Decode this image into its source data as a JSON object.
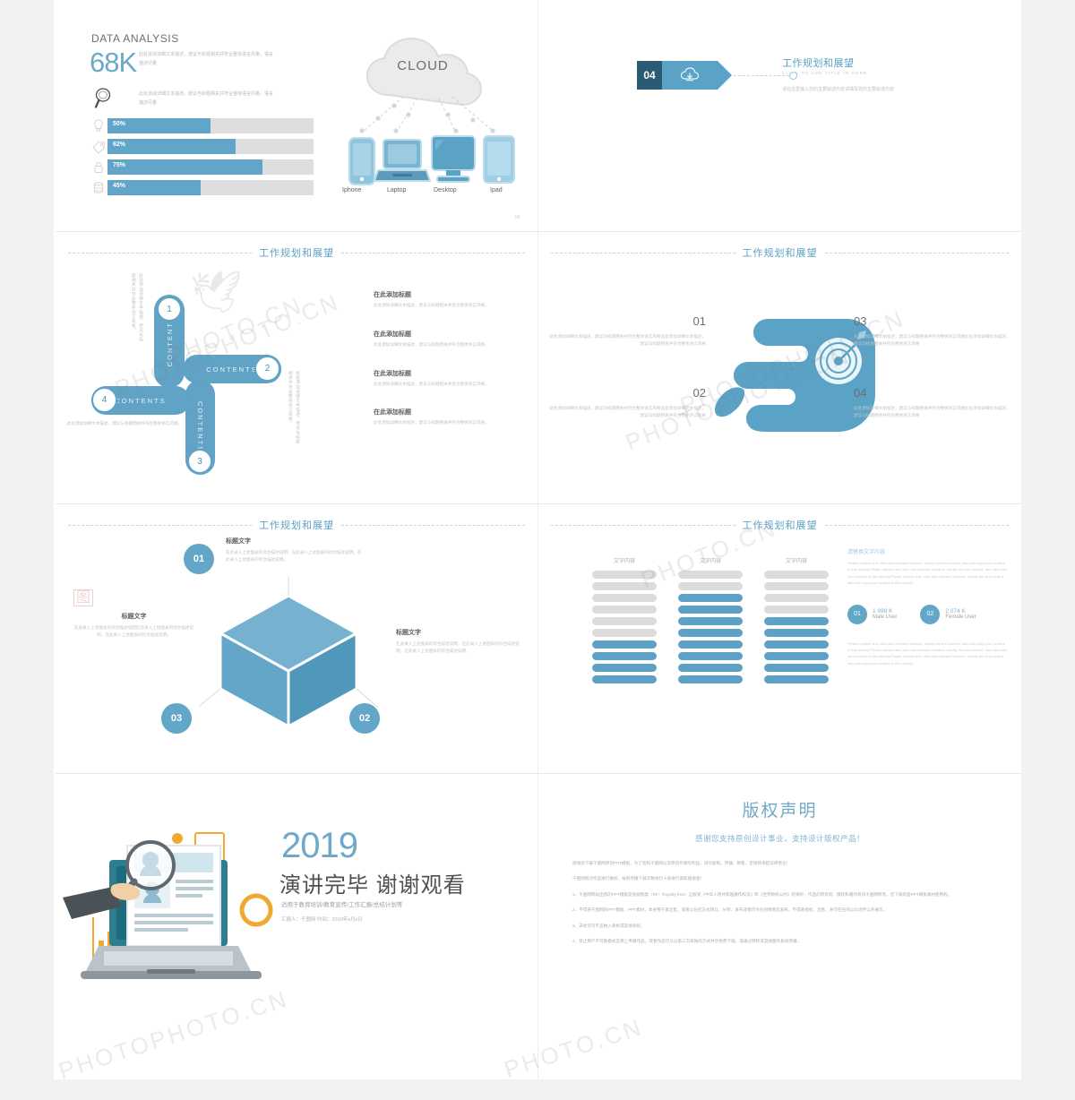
{
  "meta": {
    "accent": "#5ba3c6",
    "accent_dark": "#2b5a74",
    "bar_gray": "#dedede",
    "page_bg": "#f2f2f2"
  },
  "watermark": {
    "text": "PHOTO.CN",
    "text2": "PHOTOPHOTO.CN",
    "seal": "图"
  },
  "slide1": {
    "heading": "DATA ANALYSIS",
    "big_number": "68K",
    "desc1": "此处添加详细文本描述，建议与标题相关并符合整体语言风格，语言描述尽量",
    "desc2": "此处添加详细文本描述，建议与标题相关并符合整体语言风格，语言描述尽量",
    "bars": [
      {
        "icon": "bulb-icon",
        "label": "50%",
        "value": 50
      },
      {
        "icon": "tag-icon",
        "label": "62%",
        "value": 62
      },
      {
        "icon": "lock-icon",
        "label": "75%",
        "value": 75
      },
      {
        "icon": "database-icon",
        "label": "45%",
        "value": 45
      }
    ],
    "cloud_label": "CLOUD",
    "devices": [
      {
        "icon": "iphone-icon",
        "label": "Iphone"
      },
      {
        "icon": "laptop-icon",
        "label": "Laptop"
      },
      {
        "icon": "desktop-icon",
        "label": "Desktop"
      },
      {
        "icon": "ipad-icon",
        "label": "Ipad"
      }
    ],
    "page_number": "18"
  },
  "slide2": {
    "badge_number": "04",
    "badge_icon": "cloud-download-icon",
    "title": "工作规划和展望",
    "subtitle": "CLICK TO ADD TITLE IN HERE",
    "body": "请在这里输入您的主要叙述内容请填写您的主要叙述内容"
  },
  "slide3": {
    "header_title": "工作规划和展望",
    "capsule_label": "CONTENTS",
    "numbers": [
      "1",
      "2",
      "3",
      "4"
    ],
    "side_texts": [
      "此处添加详细文本描述，建议与标题相关并符合整体语言风格。",
      "此处添加详细文本描述，建议与标题相关并符合整体语言风格。",
      "此处添加详细文本描述，建议与标题相关并符合整体语言风格。"
    ],
    "items": [
      {
        "title": "在此添加标题",
        "desc": "此处添加详细文本描述，建议与标题相关并符合整体语言风格。"
      },
      {
        "title": "在此添加标题",
        "desc": "此处添加详细文本描述，建议与标题相关并符合整体语言风格。"
      },
      {
        "title": "在此添加标题",
        "desc": "此处添加详细文本描述，建议与标题相关并符合整体语言风格。"
      },
      {
        "title": "在此添加标题",
        "desc": "此处添加详细文本描述，建议与标题相关并符合整体语言风格。"
      }
    ]
  },
  "slide4": {
    "header_title": "工作规划和展望",
    "graphic": "hand-holding-target-icon",
    "left_items": [
      {
        "num": "01",
        "desc": "此处添加详细文本描述，建议与标题相关并符合整体语言风格此处添加详细文本描述，建议与标题相关并符合整体语言风格"
      },
      {
        "num": "02",
        "desc": "此处添加详细文本描述，建议与标题相关并符合整体语言风格此处添加详细文本描述，建议与标题相关并符合整体语言风格"
      }
    ],
    "right_items": [
      {
        "num": "03",
        "desc": "此处添加详细文本描述，建议与标题相关并符合整体语言风格此处添加详细文本描述，建议与标题相关并符合整体语言风格"
      },
      {
        "num": "04",
        "desc": "此处添加详细文本描述，建议与标题相关并符合整体语言风格此处添加详细文本描述，建议与标题相关并符合整体语言风格"
      }
    ]
  },
  "slide5": {
    "header_title": "工作规划和展望",
    "graphic": "isometric-cube-icon",
    "items": [
      {
        "num": "01",
        "title": "标题文字",
        "desc": "在此录入上述图表的综合描述说明，在此录入上述图表的综合描述说明，在此录入上述图表的综合描述说明。"
      },
      {
        "num": "02",
        "title": "标题文字",
        "desc": "在此录入上述图表的综合描述说明，在此录入上述图表的综合描述说明，在此录入上述图表的综合描述说明。"
      },
      {
        "num": "03",
        "title": "标题文字",
        "desc": "在此录入上述图表的综合描述说明在此录入上述图表的综合描述说明，在此录入上述图表的综合描述说明。"
      }
    ]
  },
  "slide6": {
    "header_title": "工作规划和展望",
    "panel_title": "请替换文字内容",
    "panel_desc_top": "Please replace text, click add relevant headline, modify the text content, also can copy your content to this directly.Please replace text, click add relevant headline, modify the text content, also can copy your content to this directly.Please replace text, click add relevant headline, modify the text content, also can copy your content to this directly.",
    "panel_desc_bottom": "Please replace text, click add relevant headline, modify the text content, also can copy your content to this directly.Please replace text, click add relevant headline, modify the text content, also can copy your content to this directly.Please replace text, click add relevant headline, modify the text content, also can copy your content to this directly.",
    "stats": [
      {
        "num": "01",
        "value": "1 998 K",
        "label": "Male User"
      },
      {
        "num": "02",
        "value": "2 074 K",
        "label": "Female User"
      }
    ],
    "chart_data": {
      "type": "bar",
      "title": "",
      "categories": [
        "文字内容",
        "文字内容",
        "文字内容"
      ],
      "values": [
        4,
        8,
        6
      ],
      "total_segments": 10,
      "xlabel": "",
      "ylabel": "",
      "ylim": [
        0,
        10
      ],
      "series": [
        {
          "name": "文字内容",
          "filled": 4,
          "empty": 6
        },
        {
          "name": "文字内容",
          "filled": 8,
          "empty": 2
        },
        {
          "name": "文字内容",
          "filled": 6,
          "empty": 4
        }
      ]
    }
  },
  "slide7": {
    "graphic": "laptop-resume-search-icon",
    "year": "2019",
    "thanks": "演讲完毕 谢谢观看",
    "subtitle": "适用于教育培训/教育宣传/工作汇报/总结计划等",
    "meta": "汇报人：千图网      时间：2019年x月x日"
  },
  "slide8": {
    "title": "版权声明",
    "subtitle": "感谢您支持原创设计事业，支持设计版权产品！",
    "paragraphs": [
      "感谢您下载千图网原创PPT模板，为了您和千图网以及原创作者的利益，请勿复制、传播、销售，否则将承担法律责任！",
      "千图网将对作品进行维权，按照传播下载次数进行十倍进行索取赔偿金！",
      "1、千图网网站出售的PPT模板是免版税类（RF：Royalty-free）正版受《中华人民共和国著作权法》和《世界版权公约》的保护，作品的所有权、版权和著作权归千图网所有，您下载的是PPT模板素材使用权。",
      "2、不得将千图网的PPT模板、PPT素材，本身用于再出售，或者以任何方式转让、分转、发布或者作为任何附赠品发布，不得商授权、出售、并可在任何公众场所公开展示。",
      "3、未经许可不品纳入商标或其他商标。",
      "4、禁止用户不可能模式应用上传播作品，或者作品可以以第三方单独的方式共享免费下载，或通过转移或其他服务系统传播。"
    ]
  }
}
